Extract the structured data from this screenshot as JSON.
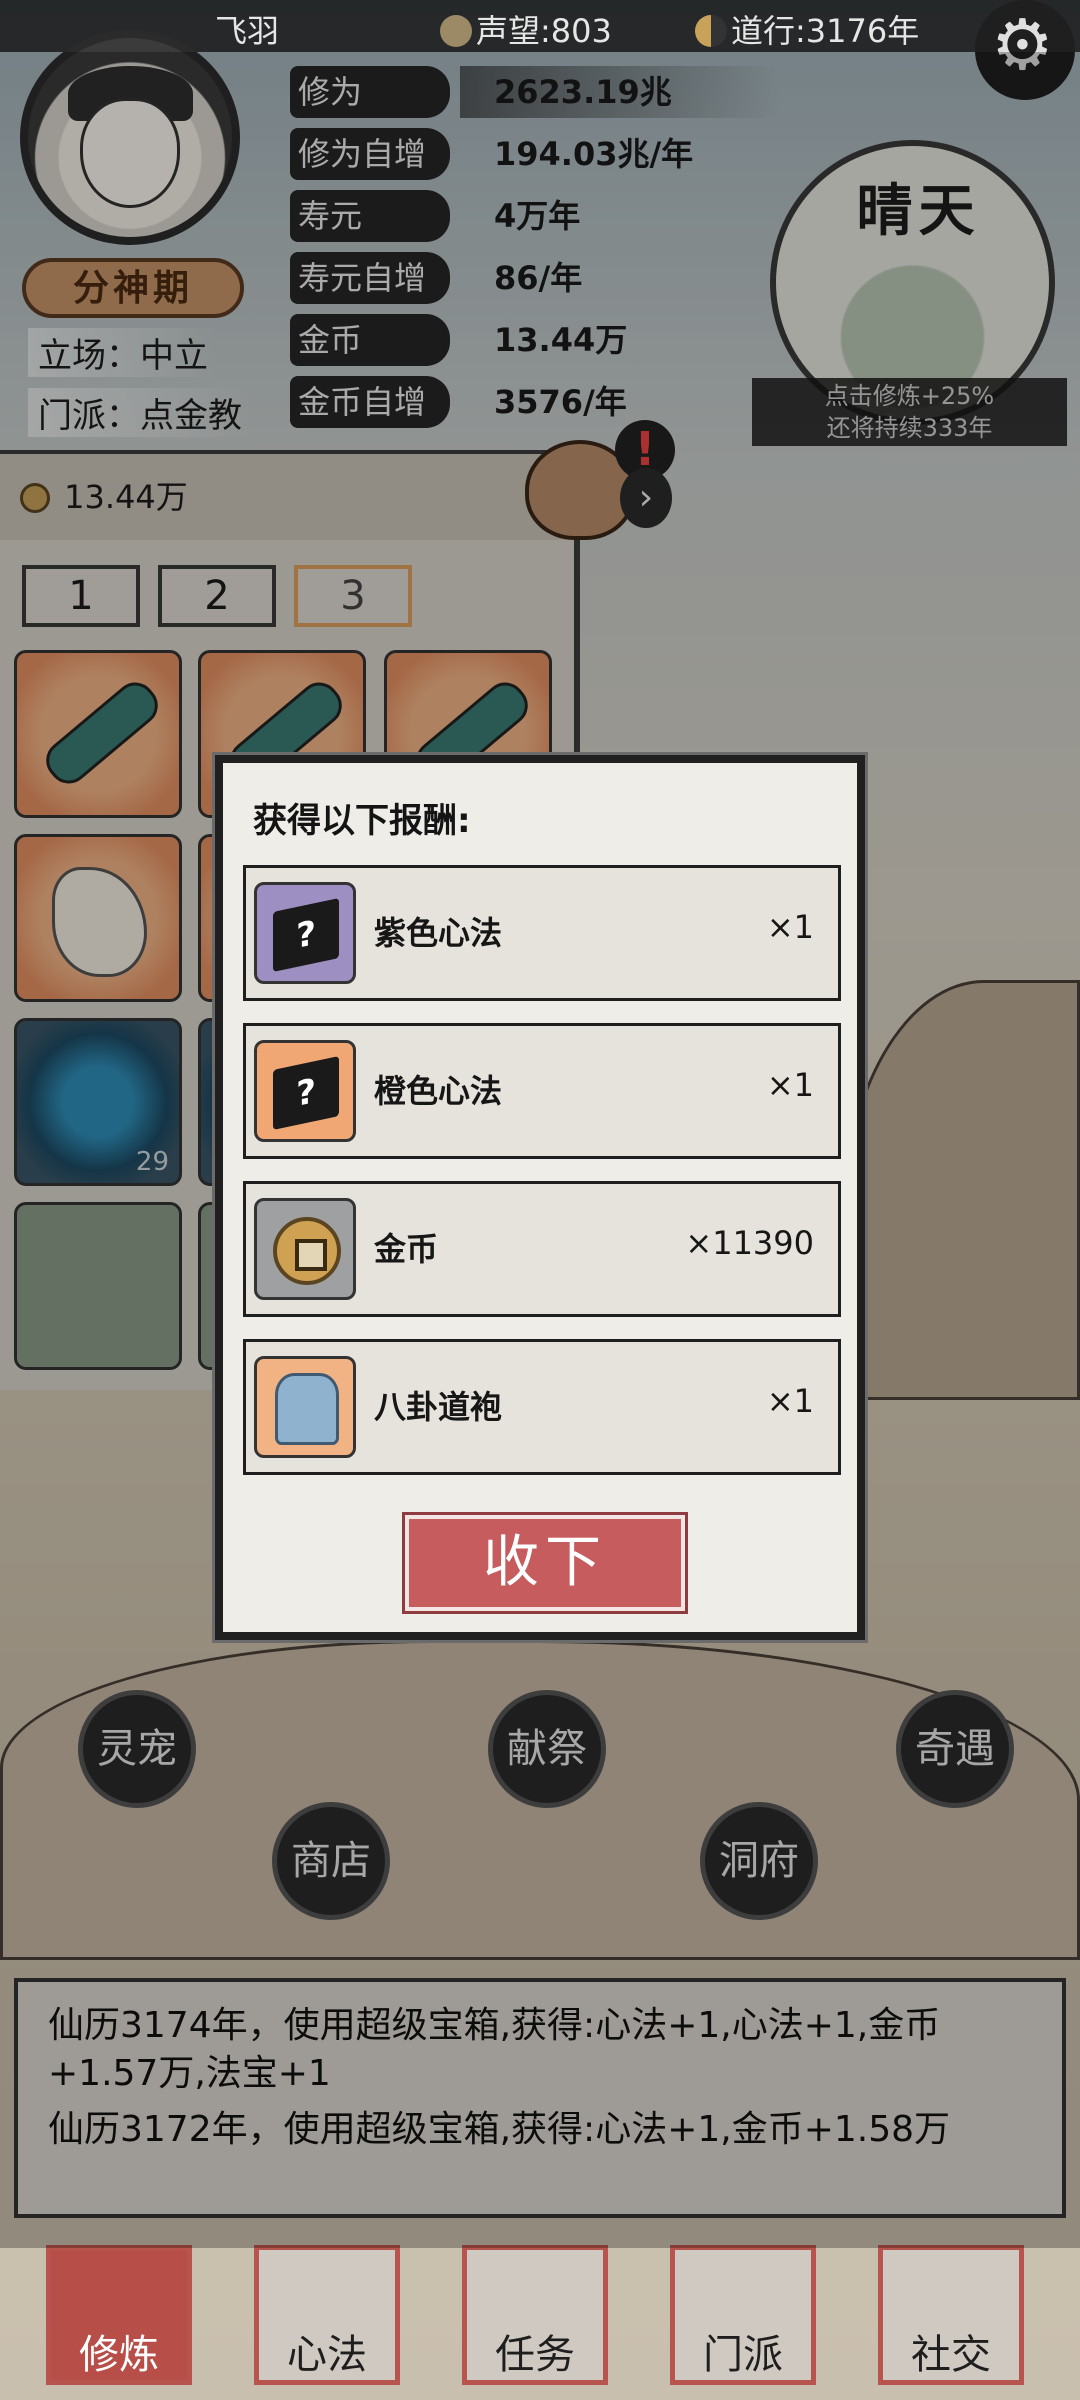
{
  "topbar": {
    "player_name": "飞羽",
    "reputation": "声望:803",
    "daoxing": "道行:3176年"
  },
  "player": {
    "realm": "分神期",
    "stance": "立场：中立",
    "sect": "门派：点金教"
  },
  "stats": [
    {
      "label": "修为",
      "value": "2623.19兆"
    },
    {
      "label": "修为自增",
      "value": "194.03兆/年"
    },
    {
      "label": "寿元",
      "value": "4万年"
    },
    {
      "label": "寿元自增",
      "value": "86/年"
    },
    {
      "label": "金币",
      "value": "13.44万"
    },
    {
      "label": "金币自增",
      "value": "3576/年"
    }
  ],
  "weather": {
    "title": "晴天",
    "line1": "点击修炼+25%",
    "line2": "还将持续333年"
  },
  "inventory": {
    "gold": "13.44万",
    "tabs": [
      "1",
      "2",
      "3"
    ],
    "count_badge": "29"
  },
  "modal": {
    "title": "获得以下报酬:",
    "rewards": [
      {
        "name": "紫色心法",
        "qty": "×1"
      },
      {
        "name": "橙色心法",
        "qty": "×1"
      },
      {
        "name": "金币",
        "qty": "×11390"
      },
      {
        "name": "八卦道袍",
        "qty": "×1"
      }
    ],
    "accept_label": "收下"
  },
  "actions": {
    "pet": "灵宠",
    "sacrifice": "献祭",
    "encounter": "奇遇",
    "shop": "商店",
    "cave": "洞府"
  },
  "log": [
    "仙历3174年，使用超级宝箱,获得:心法+1,心法+1,金币+1.57万,法宝+1",
    "仙历3172年，使用超级宝箱,获得:心法+1,金币+1.58万"
  ],
  "nav": [
    "修炼",
    "心法",
    "任务",
    "门派",
    "社交"
  ],
  "colors": {
    "accent_red": "#c75c5f",
    "nav_border": "#b7544d"
  }
}
